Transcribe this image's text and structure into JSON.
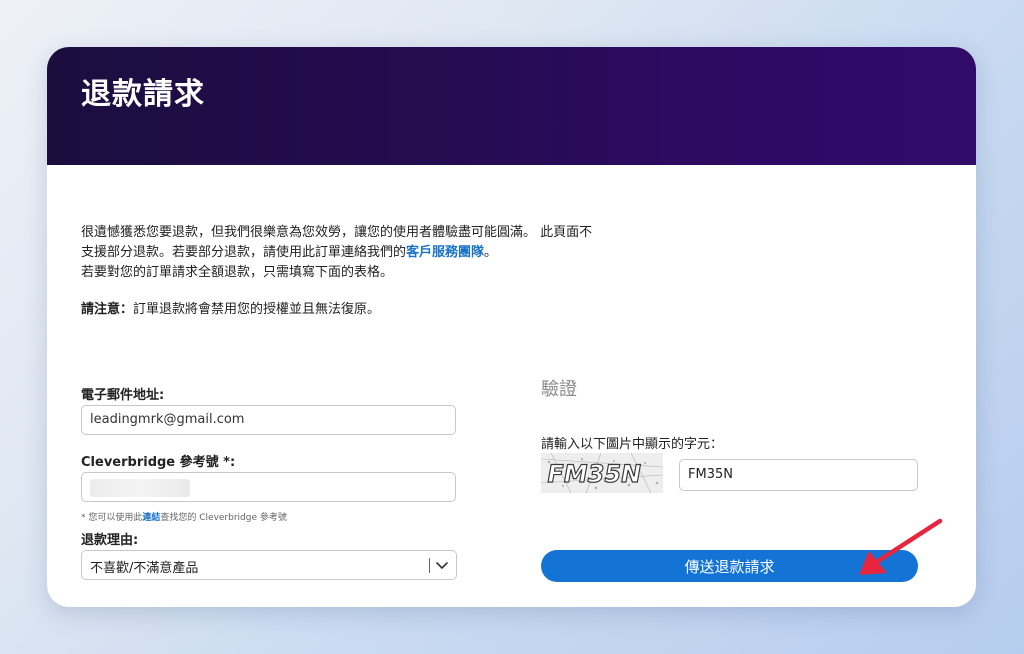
{
  "header": {
    "title": "退款請求"
  },
  "intro": {
    "line1": "很遺憾獲悉您要退款，但我們很樂意為您效勞，讓您的使用者體驗盡可能圓滿。 此頁面不",
    "line2_prefix": "支援部分退款。若要部分退款，請使用此訂單連絡我們的",
    "line2_link": "客戶服務團隊",
    "line2_suffix": "。",
    "line3": "若要對您的訂單請求全額退款，只需填寫下面的表格。"
  },
  "notice": {
    "label": "請注意：",
    "text": "訂單退款將會禁用您的授權並且無法復原。"
  },
  "form": {
    "email_label": "電子郵件地址:",
    "email_value": "leadingmrk@gmail.com",
    "reference_label": "Cleverbridge 參考號 *:",
    "reference_value": "",
    "hint_prefix": "* 您可以使用此",
    "hint_link": "連結",
    "hint_suffix": "查找您的 Cleverbridge 參考號",
    "reason_label": "退款理由:",
    "reason_selected": "不喜歡/不滿意產品"
  },
  "verification": {
    "title": "驗證",
    "captcha_label": "請輸入以下圖片中顯示的字元：",
    "captcha_image_text": "FM35N",
    "captcha_value": "FM35N",
    "submit_label": "傳送退款請求"
  },
  "colors": {
    "header_start": "#1c0d3e",
    "header_end": "#300b68",
    "link": "#1a73c9",
    "button": "#1474d6",
    "annotation_arrow": "#e8243f"
  },
  "icons": {
    "chevron": "chevron-down-icon",
    "annotation": "arrow-annotation-icon"
  }
}
